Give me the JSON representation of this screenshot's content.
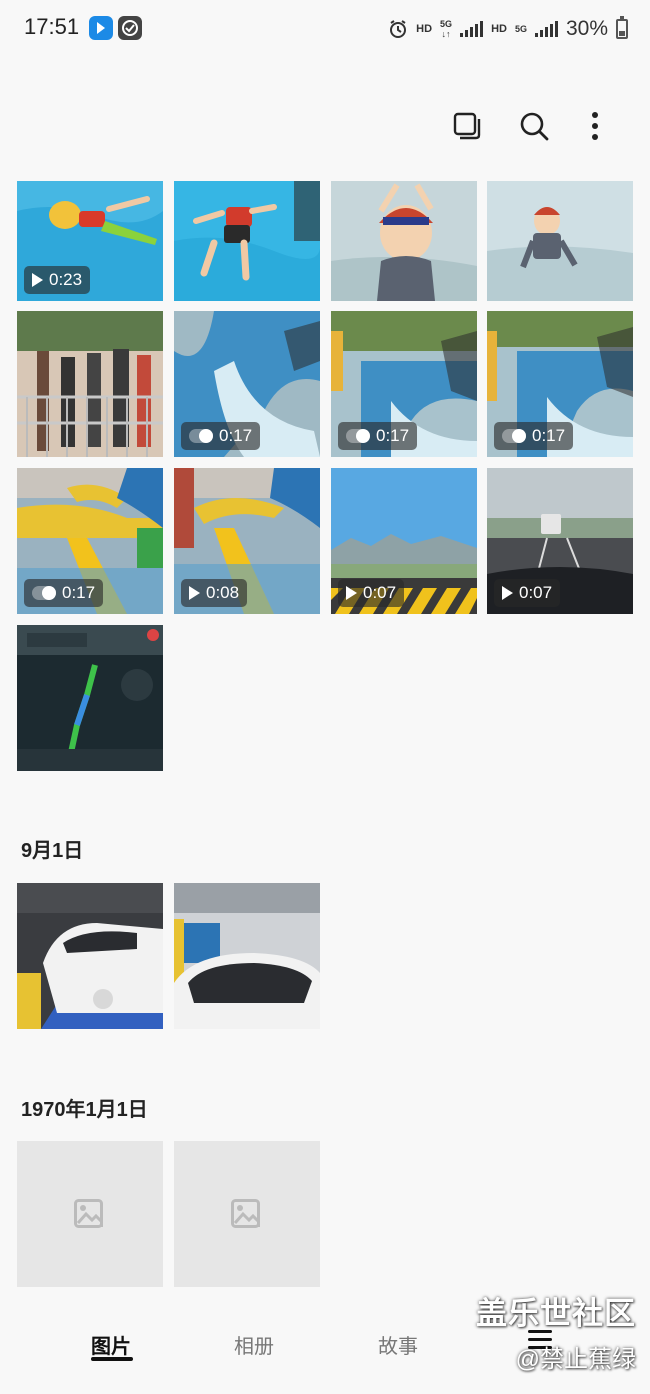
{
  "status_bar": {
    "time": "17:51",
    "hd1": "HD",
    "net1_top": "5G",
    "net1_bottom": "↓↑",
    "hd2": "HD",
    "net2": "5G",
    "battery": "30%"
  },
  "toolbar": {
    "icons": [
      "select-icon",
      "search-icon",
      "more-icon"
    ]
  },
  "grid_top": {
    "items": [
      {
        "badge": "0:23",
        "type": "video"
      },
      {
        "badge": "",
        "type": "photo"
      },
      {
        "badge": "",
        "type": "photo"
      },
      {
        "badge": "",
        "type": "photo"
      },
      {
        "badge": "",
        "type": "photo"
      },
      {
        "badge": "0:17",
        "type": "live"
      },
      {
        "badge": "0:17",
        "type": "live"
      },
      {
        "badge": "0:17",
        "type": "live"
      },
      {
        "badge": "0:17",
        "type": "live"
      },
      {
        "badge": "0:08",
        "type": "video"
      },
      {
        "badge": "0:07",
        "type": "video"
      },
      {
        "badge": "0:07",
        "type": "video"
      },
      {
        "badge": "",
        "type": "photo"
      }
    ]
  },
  "sections": [
    {
      "title": "9月1日"
    },
    {
      "title": "1970年1月1日"
    }
  ],
  "bottom_nav": {
    "tabs": [
      "图片",
      "相册",
      "故事"
    ],
    "active": "图片"
  },
  "watermark": {
    "line1": "盖乐世社区",
    "line2": "@禁止蕉绿"
  },
  "colors": {
    "background": "#f8f8f8",
    "pool_blue": "#3fb0e0",
    "broken_tile": "#e6e6e6"
  }
}
